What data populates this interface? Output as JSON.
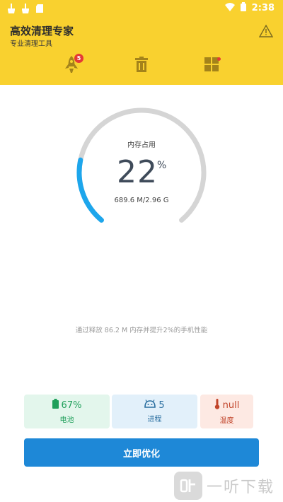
{
  "status_bar": {
    "time": "2:38"
  },
  "header": {
    "title": "高效清理专家",
    "subtitle": "专业清理工具"
  },
  "nav": {
    "boost_badge": "5"
  },
  "gauge": {
    "label": "内存占用",
    "value": "22",
    "unit": "%",
    "detail": "689.6 M/2.96 G",
    "percent": 0.22
  },
  "tip": "通过释放 86.2 M 内存并提升2%的手机性能",
  "stats": {
    "battery": {
      "value": "67%",
      "label": "电池"
    },
    "process": {
      "value": "5",
      "label": "进程"
    },
    "temp": {
      "value": "null",
      "label": "温度"
    }
  },
  "action": {
    "optimize_label": "立即优化"
  },
  "watermark": {
    "text": "一听下载"
  },
  "colors": {
    "header": "#F9D12F",
    "gauge_progress": "#1DA6EC",
    "gauge_track": "#D5D5D5",
    "button": "#1E88D7"
  }
}
